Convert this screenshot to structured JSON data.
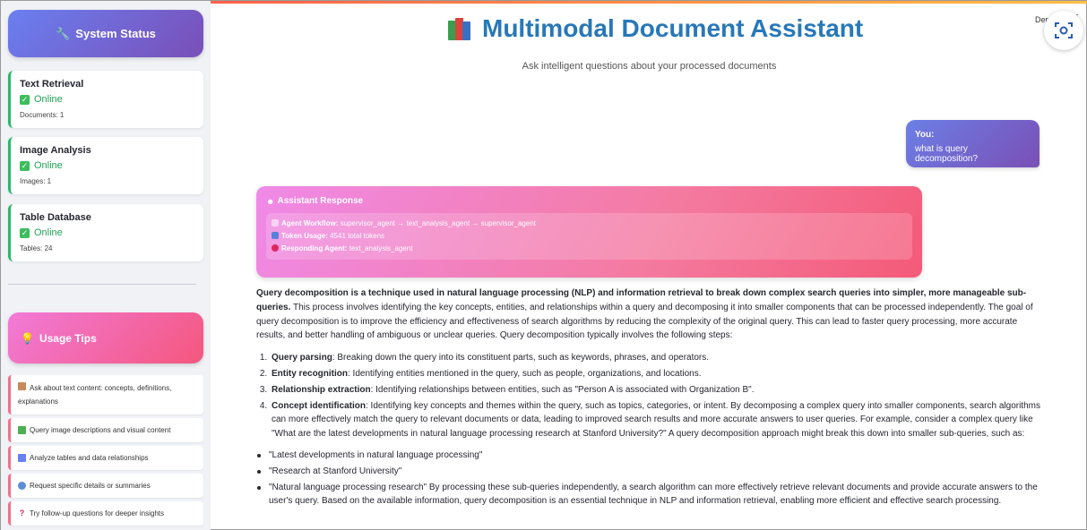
{
  "sidebar": {
    "system_status_title": "System Status",
    "services": [
      {
        "name": "Text Retrieval",
        "status": "Online",
        "meta": "Documents: 1"
      },
      {
        "name": "Image Analysis",
        "status": "Online",
        "meta": "Images: 1"
      },
      {
        "name": "Table Database",
        "status": "Online",
        "meta": "Tables: 24"
      }
    ],
    "usage_tips_title": "Usage Tips",
    "tips": [
      "Ask about text content: concepts, definitions, explanations",
      "Query image descriptions and visual content",
      "Analyze tables and data relationships",
      "Request specific details or summaries",
      "Try follow-up questions for deeper insights"
    ]
  },
  "header": {
    "title": "Multimodal Document Assistant",
    "subtitle": "Ask intelligent questions about your processed documents",
    "deploy_label": "Deploy",
    "menu_label": "⋮"
  },
  "chat": {
    "user_label": "You:",
    "user_message": "what is query decomposition?",
    "assistant_title": "Assistant Response",
    "agent_workflow_label": "Agent Workflow:",
    "agent_workflow_value": "supervisor_agent → text_analysis_agent → supervisor_agent",
    "token_usage_label": "Token Usage:",
    "token_usage_value": "4541 total tokens",
    "responding_agent_label": "Responding Agent:",
    "responding_agent_value": "text_analysis_agent"
  },
  "answer": {
    "intro_bold": "Query decomposition is a technique used in natural language processing (NLP) and information retrieval to break down complex search queries into simpler, more manageable sub-queries.",
    "intro_rest": " This process involves identifying the key concepts, entities, and relationships within a query and decomposing it into smaller components that can be processed independently. The goal of query decomposition is to improve the efficiency and effectiveness of search algorithms by reducing the complexity of the original query. This can lead to faster query processing, more accurate results, and better handling of ambiguous or unclear queries. Query decomposition typically involves the following steps:",
    "steps": [
      {
        "term": "Query parsing",
        "text": ": Breaking down the query into its constituent parts, such as keywords, phrases, and operators."
      },
      {
        "term": "Entity recognition",
        "text": ": Identifying entities mentioned in the query, such as people, organizations, and locations."
      },
      {
        "term": "Relationship extraction",
        "text": ": Identifying relationships between entities, such as \"Person A is associated with Organization B\"."
      },
      {
        "term": "Concept identification",
        "text": ": Identifying key concepts and themes within the query, such as topics, categories, or intent. By decomposing a complex query into smaller components, search algorithms can more effectively match the query to relevant documents or data, leading to improved search results and more accurate answers to user queries. For example, consider a complex query like \"What are the latest developments in natural language processing research at Stanford University?\" A query decomposition approach might break this down into smaller sub-queries, such as:"
      }
    ],
    "bullets": [
      "\"Latest developments in natural language processing\"",
      "\"Research at Stanford University\"",
      "\"Natural language processing research\" By processing these sub-queries independently, a search algorithm can more effectively retrieve relevant documents and provide accurate answers to the user's query. Based on the available information, query decomposition is an essential technique in NLP and information retrieval, enabling more efficient and effective search processing."
    ]
  },
  "colors": {
    "title_blue": "#2878b8",
    "status_gradient": [
      "#6a7ff0",
      "#7a4fb8"
    ],
    "tips_gradient": [
      "#f27ad8",
      "#f4577d"
    ],
    "online_green": "#21a356"
  }
}
